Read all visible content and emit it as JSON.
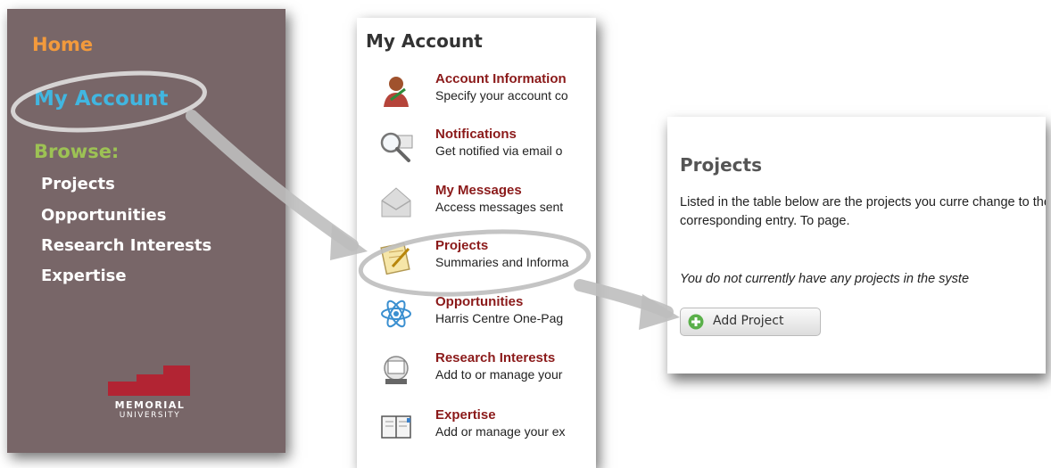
{
  "sidebar": {
    "home": "Home",
    "my_account": "My Account",
    "browse": "Browse:",
    "items": [
      "Projects",
      "Opportunities",
      "Research Interests",
      "Expertise"
    ],
    "logo": {
      "line1": "MEMORIAL",
      "line2": "UNIVERSITY"
    }
  },
  "account_menu": {
    "title": "My Account",
    "items": [
      {
        "label": "Account Information",
        "desc": "Specify your account co",
        "icon": "user-icon"
      },
      {
        "label": "Notifications",
        "desc": "Get notified via email o",
        "icon": "magnifier-icon"
      },
      {
        "label": "My Messages",
        "desc": "Access messages sent",
        "icon": "envelope-icon"
      },
      {
        "label": "Projects",
        "desc": "Summaries and Informa",
        "icon": "notepad-icon"
      },
      {
        "label": "Opportunities",
        "desc": "Harris Centre One-Pag",
        "icon": "atom-icon"
      },
      {
        "label": "Research Interests",
        "desc": "Add to or manage your",
        "icon": "rolodex-icon"
      },
      {
        "label": "Expertise",
        "desc": "Add or manage your ex",
        "icon": "book-icon"
      }
    ]
  },
  "projects_page": {
    "title": "Projects",
    "description": "Listed in the table below are the projects you curre change to the right of the corresponding entry. To page.",
    "empty_message": "You do not currently have any projects in the syste",
    "add_button": "Add Project"
  },
  "colors": {
    "sidebar_bg": "#786668",
    "home": "#f39a3c",
    "my_account": "#41b6e0",
    "browse": "#9dc254",
    "menu_label": "#8b1a1a",
    "logo_red": "#b22433"
  }
}
